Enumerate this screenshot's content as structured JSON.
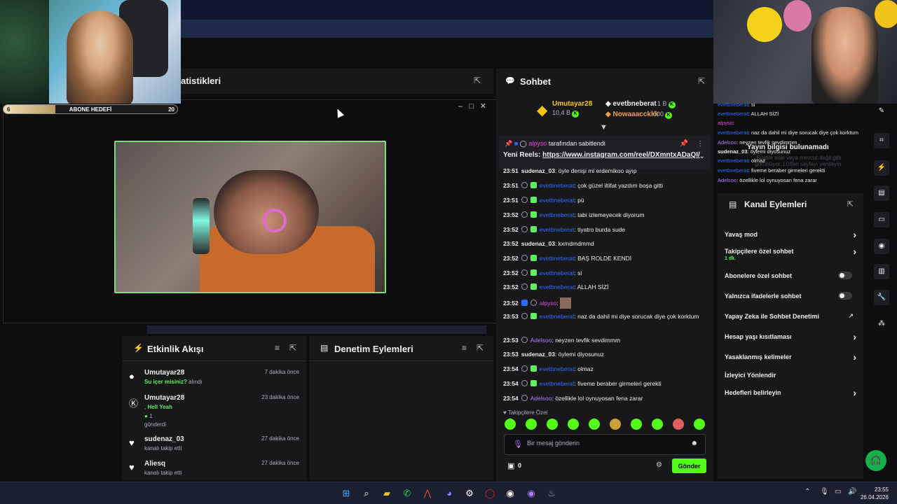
{
  "goal": {
    "label": "ABONE HEDEFİ",
    "start": "6",
    "target": "20",
    "progress": 0.3
  },
  "stats": {
    "title_fragment": "atistikleri"
  },
  "feed": {
    "title": "Etkinlik Akışı",
    "items": [
      {
        "name": "Umutayar28",
        "time": "7 dakika önce",
        "highlight": "Su içer misiniz?",
        "tail": " alındı"
      },
      {
        "name": "Umutayar28",
        "time": "23 dakika önce",
        "line1_prefix": ", ",
        "highlight": "Hell Yeah",
        "amount": "1",
        "line3": "gönderdi"
      },
      {
        "name": "sudenaz_03",
        "time": "27 dakika önce",
        "sub": "kanalı takip etti"
      },
      {
        "name": "Aliesq",
        "time": "27 dakika önce",
        "sub": "kanalı takip etti"
      }
    ]
  },
  "mod_actions": {
    "title": "Denetim Eylemleri"
  },
  "chat": {
    "title": "Sohbet",
    "leaderboard": [
      {
        "name": "Umutayar28",
        "value": "10,4 B"
      },
      {
        "name": "evetbneberat",
        "value": "1 B"
      },
      {
        "name": "Nowaaacckkk",
        "value": "500"
      }
    ],
    "pinned": {
      "user": "alpyso",
      "by_text": " tarafından sabitlendi",
      "prefix": "Yeni Reels: ",
      "link": "https://www.instagram.com/reel/DXmntxADaQI/"
    },
    "messages": [
      {
        "time": "23:51",
        "user": "sudenaz_03",
        "text": ": öyle denişi mi erdemikoo ayıp"
      },
      {
        "time": "23:51",
        "user": "evetbneberat",
        "text": ": çok güzel iltifat yazdım boşa gitti"
      },
      {
        "time": "23:51",
        "user": "evetbneberat",
        "text": ": pü"
      },
      {
        "time": "23:52",
        "user": "evetbneberat",
        "text": ": tabi izlemeyecek diyorum"
      },
      {
        "time": "23:52",
        "user": "evetbneberat",
        "text": ": tiyatro burda sude"
      },
      {
        "time": "23:52",
        "user": "sudenaz_03",
        "text": ": kxmdmdmmd"
      },
      {
        "time": "23:52",
        "user": "evetbneberat",
        "text": ": BAŞ ROLDE KENDİ"
      },
      {
        "time": "23:52",
        "user": "evetbneberat",
        "text": ": si"
      },
      {
        "time": "23:52",
        "user": "evetbneberat",
        "text": ": ALLAH SİZİ"
      },
      {
        "time": "23:52",
        "user": "alpyso",
        "text": ":"
      },
      {
        "time": "23:53",
        "user": "evetbneberat",
        "text": ": naz da dahil mi diye sorucak diye çok korktum"
      },
      {
        "time": "23:53",
        "user": "Adelsoo",
        "text": ": neyzen tevfik sevdimmm"
      },
      {
        "time": "23:53",
        "user": "sudenaz_03",
        "text": ": öylemi diyosunuz"
      },
      {
        "time": "23:54",
        "user": "evetbneberat",
        "text": ": olmaz"
      },
      {
        "time": "23:54",
        "user": "evetbneberat",
        "text": ": fiveme beraber girmeleri gerekti"
      },
      {
        "time": "23:54",
        "user": "Adelsoo",
        "text": ": özellikle lol oynuyosan fena zarar"
      }
    ],
    "emotes_label": "Takipçilere Özel",
    "input_placeholder": "Bir mesaj gönderin",
    "gift_count": "0",
    "send_label": "Gönder"
  },
  "right_chat": [
    {
      "user": "evetbneberat",
      "text": ": si"
    },
    {
      "user": "evetbneberat",
      "text": ": ALLAH SİZİ"
    },
    {
      "user": "alpyso",
      "text": ":"
    },
    {
      "user": "evetbneberat",
      "text": ": naz da dahil mi diye sorucak diye çok korktum"
    },
    {
      "user": "Adelsoo",
      "text": ": neyzen tevfik sevdimmm"
    },
    {
      "user": "sudenaz_03",
      "text": ": öylemi diyosunuz"
    },
    {
      "user": "evetbneberat",
      "text": ": olmaz"
    },
    {
      "user": "evetbneberat",
      "text": ": fiveme beraber girmeleri gerekti"
    },
    {
      "user": "Adelsoo",
      "text": ": özellikle lol oynuyosan fena zarar"
    }
  ],
  "overlay_notice": {
    "title": "Yayın bilgisi bulunamadı",
    "sub": "Bilgiler eski veya mevcut değil gibi görünüyor. Lütfen sayfayı yenileyin."
  },
  "channel_actions": {
    "title": "Kanal Eylemleri",
    "rows": [
      {
        "label": "Yavaş mod"
      },
      {
        "label": "Takipçilere özel sohbet",
        "sub": "1 dk."
      },
      {
        "label": "Abonelere özel sohbet"
      },
      {
        "label": "Yalnızca ifadelerle sohbet"
      },
      {
        "label": "Yapay Zeka ile Sohbet Denetimi"
      },
      {
        "label": "Hesap yaşı kısıtlaması"
      },
      {
        "label": "Yasaklanmış kelimeler"
      },
      {
        "label": "İzleyici Yönlendir"
      },
      {
        "label": "Hedefleri belirleyin"
      }
    ]
  },
  "clock": {
    "time": "23:55",
    "date": "26.04.2026"
  },
  "colors": {
    "accent": "#53fc18",
    "panel": "#18181b",
    "link": "#2d6bff",
    "bg": "#0e0e10"
  }
}
